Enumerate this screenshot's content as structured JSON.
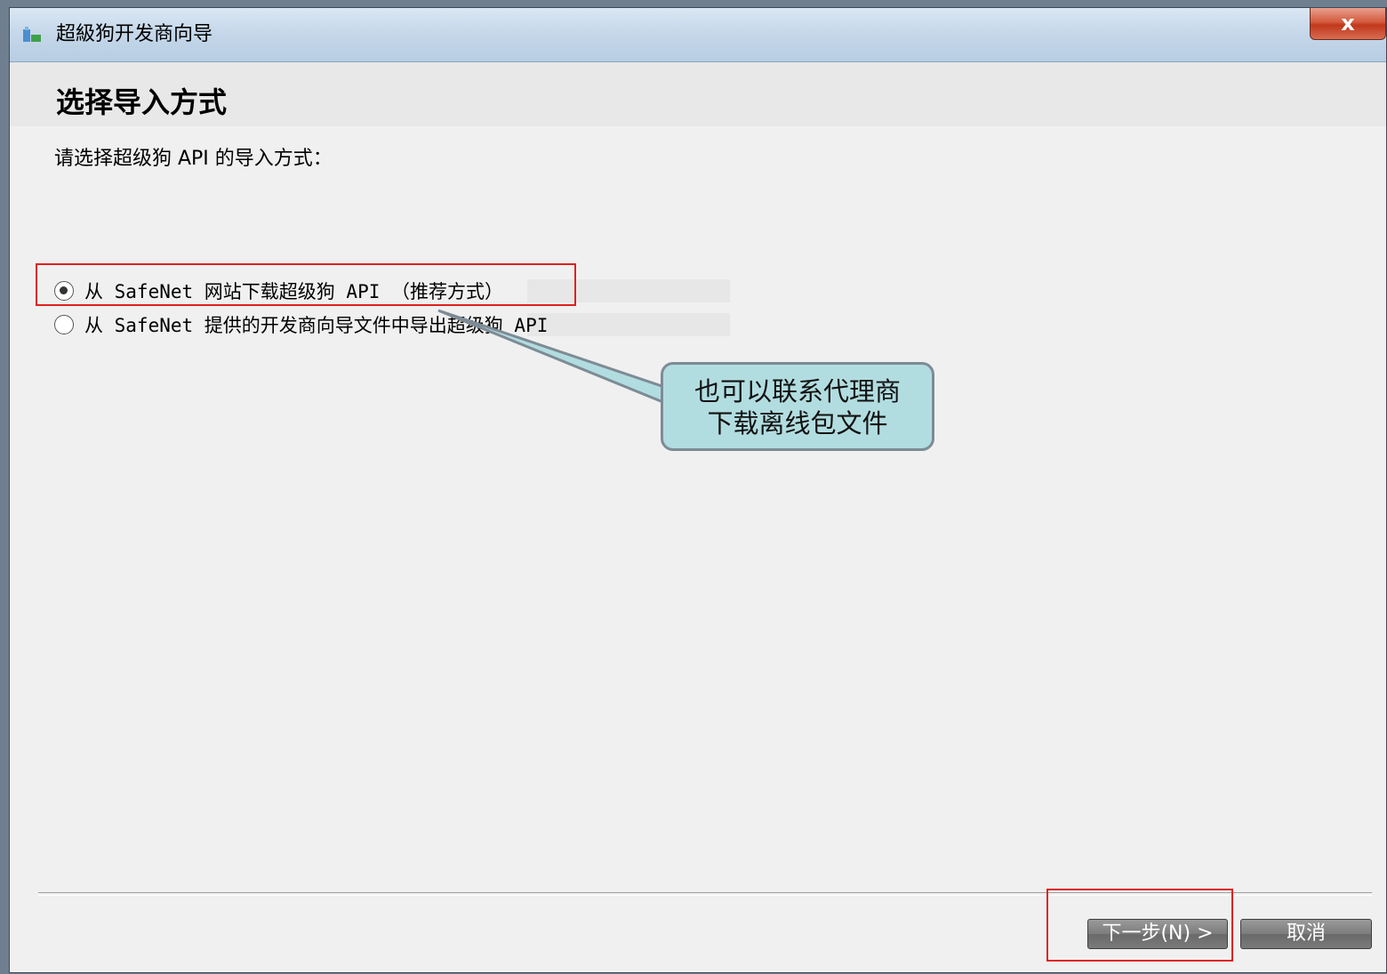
{
  "window": {
    "title": "超級狗开发商向导",
    "close_label": "x"
  },
  "header": {
    "title": "选择导入方式"
  },
  "main": {
    "instruction": "请选择超级狗 API 的导入方式：",
    "options": [
      {
        "label": "从 SafeNet 网站下载超级狗 API （推荐方式）",
        "selected": true
      },
      {
        "label": "从 SafeNet 提供的开发商向导文件中导出超级狗 API",
        "selected": false
      }
    ]
  },
  "annotation": {
    "callout_line1": "也可以联系代理商",
    "callout_line2": "下载离线包文件",
    "highlight_color": "#e02020",
    "callout_color": "#b2dde0"
  },
  "footer": {
    "next_label": "下一步(N) >",
    "cancel_label": "取消"
  }
}
